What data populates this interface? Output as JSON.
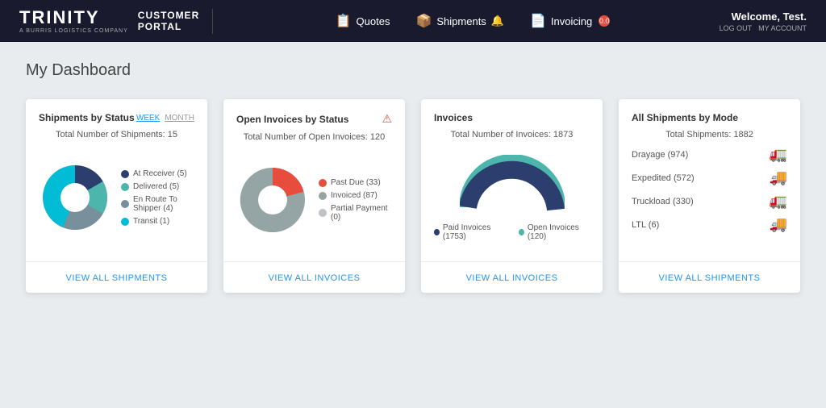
{
  "header": {
    "brand_main": "TRINITY",
    "brand_sub": "A BURRIS LOGISTICS COMPANY",
    "portal_line1": "CUSTOMER",
    "portal_line2": "PORTAL",
    "nav": [
      {
        "id": "quotes",
        "label": "Quotes",
        "icon": "📋",
        "badge": null
      },
      {
        "id": "shipments",
        "label": "Shipments",
        "icon": "📦",
        "badge": "🔔"
      },
      {
        "id": "invoicing",
        "label": "Invoicing",
        "icon": "📄",
        "badge": "0.0"
      }
    ],
    "welcome": "Welcome, Test.",
    "logout_label": "LOG OUT",
    "account_label": "MY ACCOUNT"
  },
  "page": {
    "title": "My Dashboard"
  },
  "cards": [
    {
      "id": "shipments-by-status",
      "title": "Shipments by Status",
      "time_week": "WEEK",
      "time_month": "MONTH",
      "active_time": "WEEK",
      "total_label": "Total Number of Shipments: 15",
      "legend": [
        {
          "label": "At Receiver (5)",
          "color": "#2c3e6e"
        },
        {
          "label": "Delivered (5)",
          "color": "#4db6ac"
        },
        {
          "label": "En Route To Shipper (4)",
          "color": "#78909c"
        },
        {
          "label": "Transit (1)",
          "color": "#00bcd4"
        }
      ],
      "footer_link": "VIEW ALL SHIPMENTS"
    },
    {
      "id": "open-invoices-by-status",
      "title": "Open Invoices by Status",
      "has_alert": true,
      "total_label": "Total Number of Open Invoices: 120",
      "legend": [
        {
          "label": "Past Due (33)",
          "color": "#e74c3c"
        },
        {
          "label": "Invoiced (87)",
          "color": "#95a5a6"
        },
        {
          "label": "Partial Payment (0)",
          "color": "#bdc3c7"
        }
      ],
      "footer_link": "VIEW ALL INVOICES"
    },
    {
      "id": "invoices",
      "title": "Invoices",
      "total_label": "Total Number of Invoices: 1873",
      "donut_legend": [
        {
          "label": "Paid Invoices (1753)",
          "color": "#2c3e6e"
        },
        {
          "label": "Open Invoices (120)",
          "color": "#4db6ac"
        }
      ],
      "footer_link": "VIEW ALL INVOICES"
    },
    {
      "id": "all-shipments-by-mode",
      "title": "All Shipments by Mode",
      "total_label": "Total Shipments: 1882",
      "modes": [
        {
          "label": "Drayage (974)",
          "icon": "🚛",
          "color": "#7b2d8b"
        },
        {
          "label": "Expedited (572)",
          "icon": "🚚",
          "color": "#e67e22"
        },
        {
          "label": "Truckload (330)",
          "icon": "🚛",
          "color": "#2c3e50"
        },
        {
          "label": "LTL (6)",
          "icon": "🚚",
          "color": "#27ae60"
        }
      ],
      "footer_link": "VIEW ALL SHIPMENTS"
    }
  ]
}
